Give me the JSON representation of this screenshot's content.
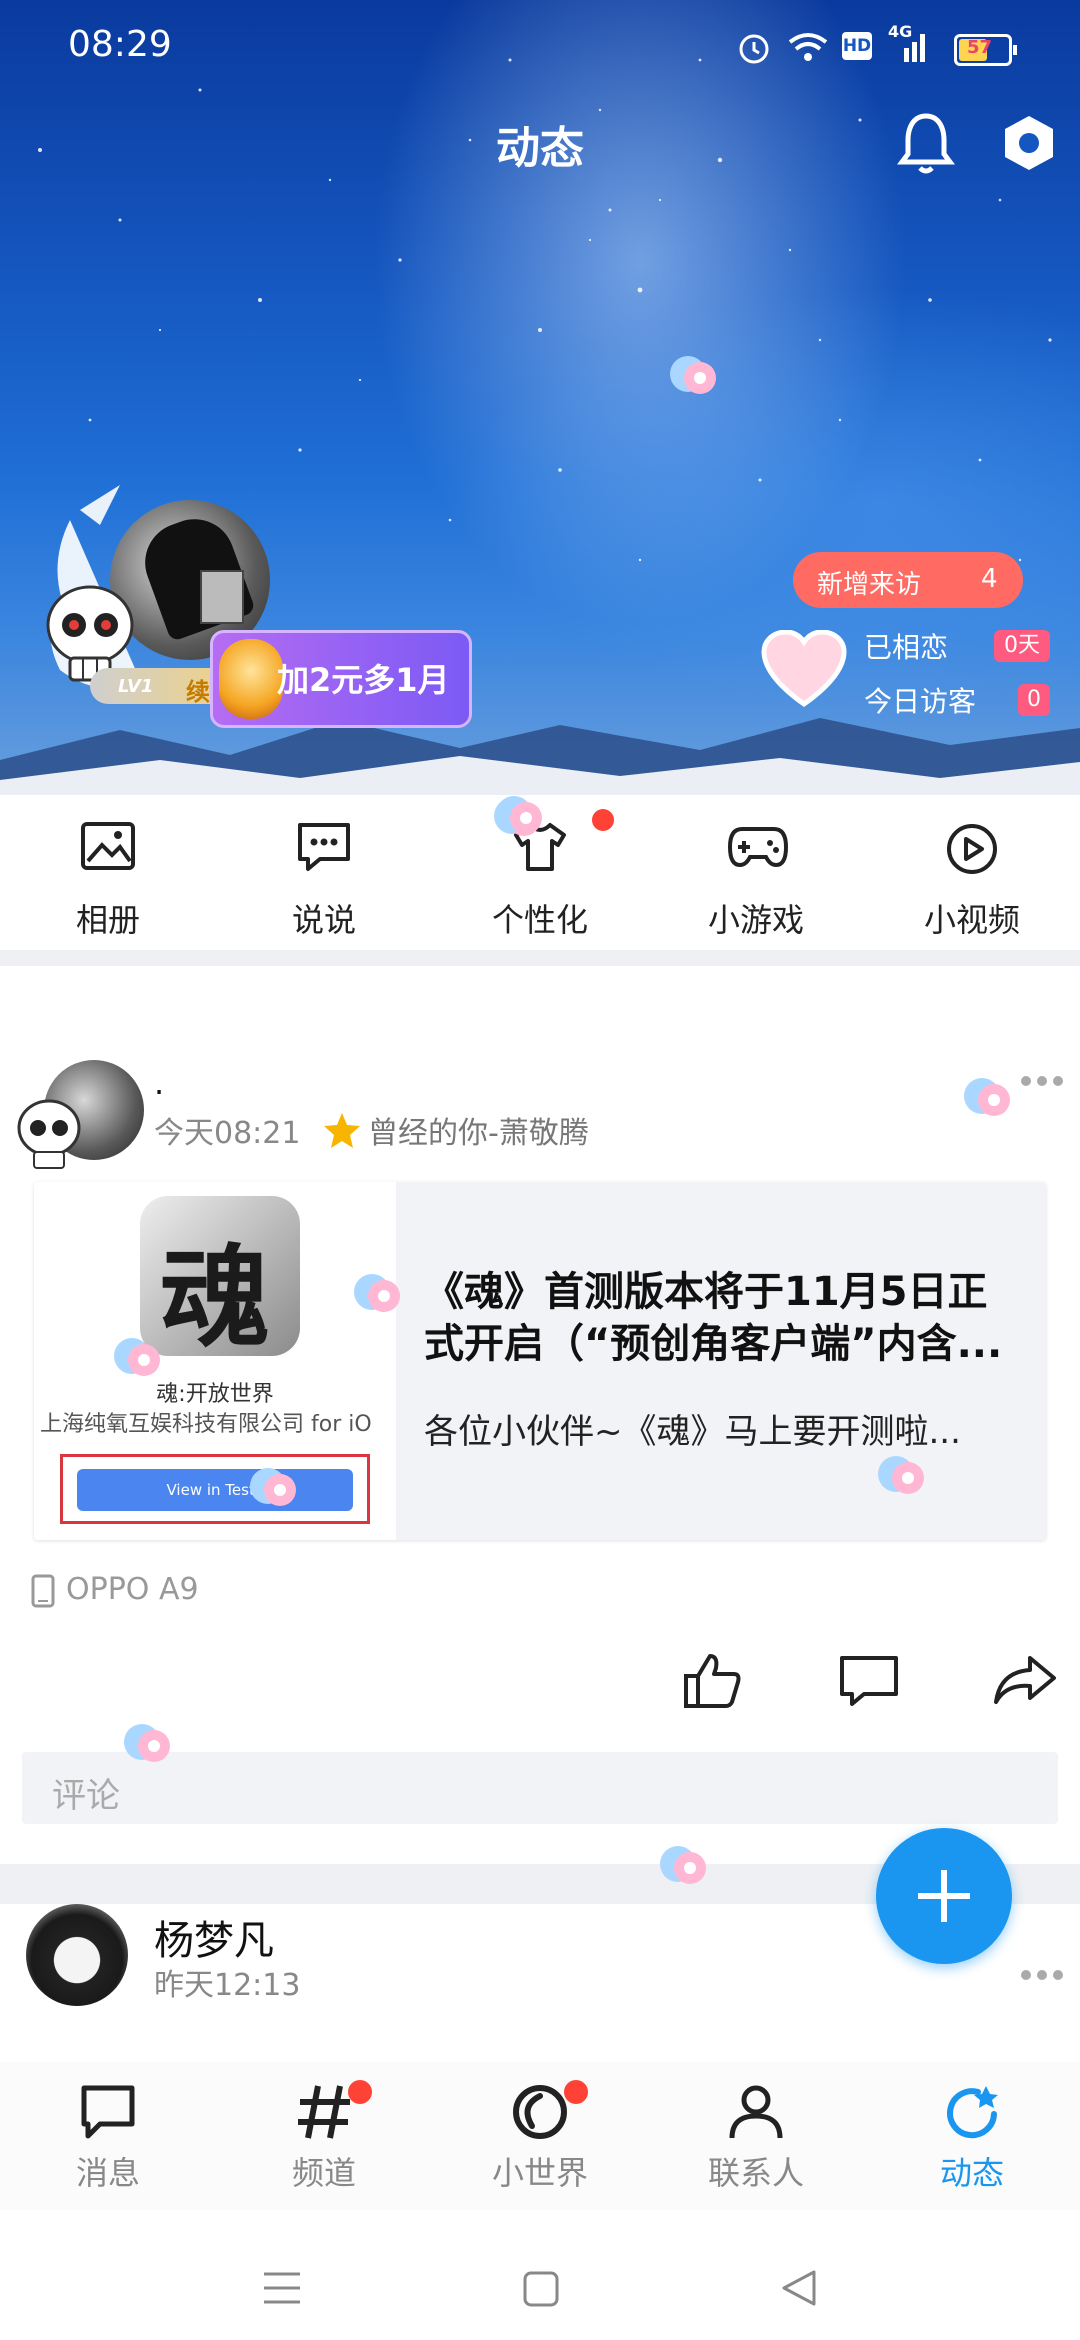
{
  "status_bar": {
    "time": "08:29",
    "network": "4G",
    "battery": "57"
  },
  "header": {
    "title": "动态"
  },
  "profile": {
    "level": "LV1",
    "renew_label": "续费",
    "promo_label": "加2元多1月"
  },
  "visitors": {
    "new_visits_label": "新增来访",
    "new_visits_count": "4",
    "together_label": "已相恋",
    "together_value": "0天",
    "today_label": "今日访客",
    "today_value": "0"
  },
  "quick_actions": [
    {
      "label": "相册",
      "icon": "photo-album-icon"
    },
    {
      "label": "说说",
      "icon": "chat-bubble-icon"
    },
    {
      "label": "个性化",
      "icon": "tshirt-icon"
    },
    {
      "label": "小游戏",
      "icon": "gamepad-icon"
    },
    {
      "label": "小视频",
      "icon": "play-circle-icon"
    }
  ],
  "post1": {
    "author": ".",
    "time": "今天08:21",
    "song": "曾经的你-萧敬腾",
    "card": {
      "thumb_char": "魂",
      "thumb_caption": "魂:开放世界",
      "thumb_company": "上海纯氧互娱科技有限公司 for iO",
      "thumb_button": "View in TestF",
      "title": "《魂》首测版本将于11月5日正式开启（“预创角客户端”内含...",
      "desc": "各位小伙伴~《魂》马上要开测啦..."
    },
    "device": "OPPO A9",
    "comment_placeholder": "评论"
  },
  "post2": {
    "author": "杨梦凡",
    "time": "昨天12:13"
  },
  "bottom_nav": [
    {
      "label": "消息",
      "icon": "message-icon",
      "active": false,
      "dot": false
    },
    {
      "label": "频道",
      "icon": "hashtag-icon",
      "active": false,
      "dot": true
    },
    {
      "label": "小世界",
      "icon": "small-world-icon",
      "active": false,
      "dot": true
    },
    {
      "label": "联系人",
      "icon": "contacts-icon",
      "active": false,
      "dot": false
    },
    {
      "label": "动态",
      "icon": "refresh-star-icon",
      "active": true,
      "dot": false
    }
  ],
  "colors": {
    "accent": "#1a96f0",
    "badge_red": "#ff4236",
    "pill": "#ff6b63"
  }
}
